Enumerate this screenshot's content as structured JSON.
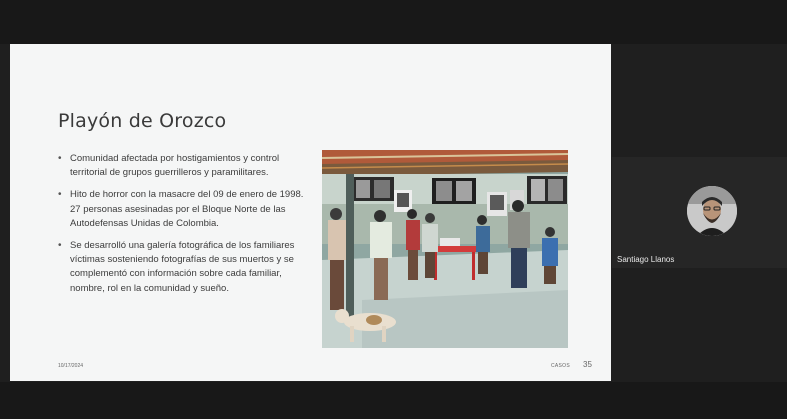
{
  "slide": {
    "title": "Playón de Orozco",
    "bullets": [
      "Comunidad afectada por hostigamientos y control territorial de grupos guerrilleros y paramilitares.",
      "Hito de horror con la masacre del 09 de enero de 1998. 27 personas asesinadas por el Bloque Norte de las Autodefensas Unidas de Colombia.",
      "Se desarrolló una galería fotográfica de los familiares víctimas sosteniendo fotografías de sus muertos y se complementó con información sobre cada familiar, nombre, rol en la comunidad y sueño."
    ],
    "date": "10/17/2024",
    "section": "CASOS",
    "page_number": "35"
  },
  "participant": {
    "name": "Santiago Llanos"
  }
}
